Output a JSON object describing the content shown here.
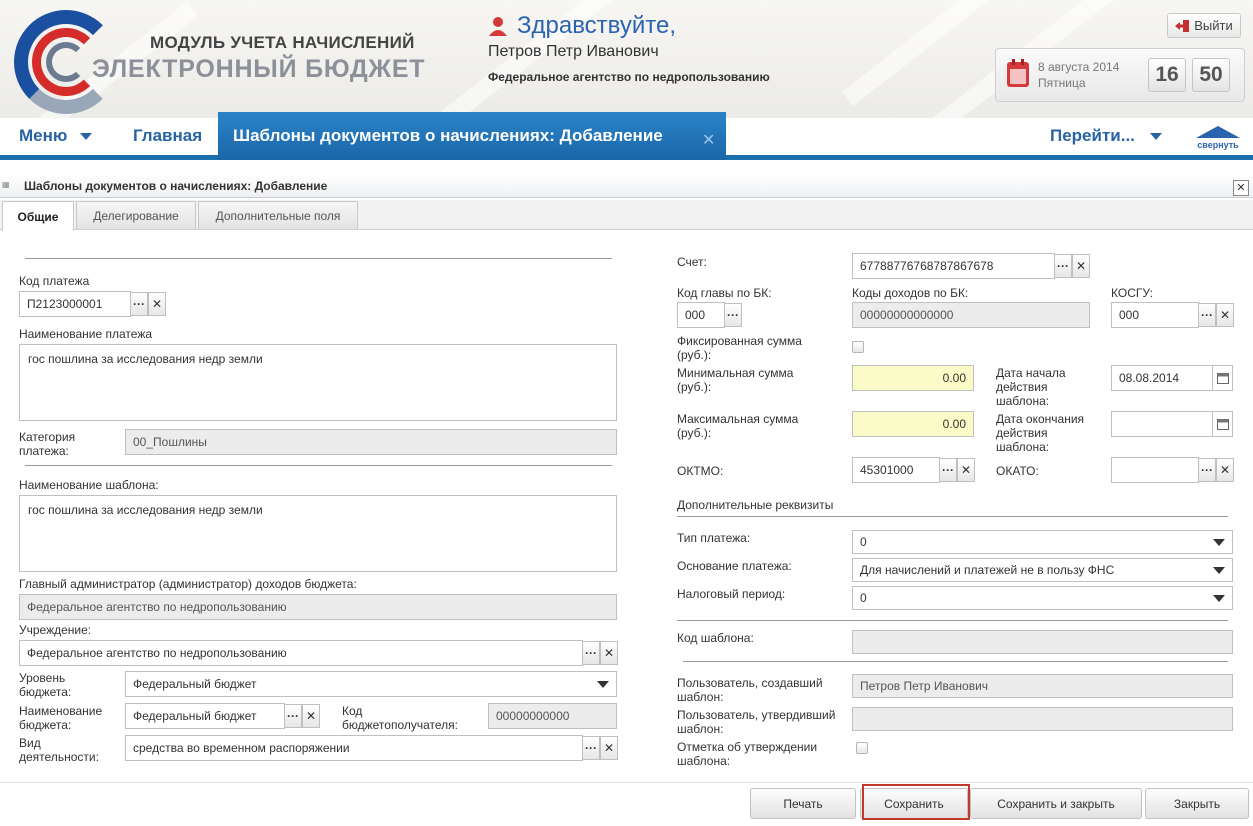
{
  "header": {
    "logo_top": "МОДУЛЬ УЧЕТА НАЧИСЛЕНИЙ",
    "logo_bottom": "ЭЛЕКТРОННЫЙ БЮДЖЕТ",
    "greeting": "Здравствуйте,",
    "user_name": "Петров Петр Иванович",
    "agency": "Федеральное агентство по недропользованию",
    "logout_label": "Выйти",
    "date": "8 августа 2014",
    "weekday": "Пятница",
    "time_hours": "16",
    "time_minutes": "50",
    "collapse_label": "свернуть"
  },
  "nav": {
    "menu_label": "Меню",
    "home_label": "Главная",
    "active_tab": "Шаблоны документов о начислениях: Добавление",
    "goto_label": "Перейти..."
  },
  "panel": {
    "title": "Шаблоны документов о начислениях: Добавление",
    "tabs": [
      "Общие",
      "Делегирование",
      "Дополнительные поля"
    ]
  },
  "left": {
    "payment_code_label": "Код платежа",
    "payment_code": "П2123000001",
    "payment_name_label": "Наименование платежа",
    "payment_name": "гос пошлина за исследования недр земли",
    "category_label": "Категория платежа:",
    "category": "00_Пошлины",
    "template_name_label": "Наименование шаблона:",
    "template_name": "гос пошлина за исследования недр земли",
    "admin_label": "Главный администратор (администратор) доходов бюджета:",
    "admin": "Федеральное агентство по недропользованию",
    "institution_label": "Учреждение:",
    "institution": "Федеральное агентство по недропользованию",
    "budget_level_label": "Уровень бюджета:",
    "budget_level": "Федеральный бюджет",
    "budget_name_label": "Наименование бюджета:",
    "budget_name": "Федеральный бюджет",
    "recipient_code_label": "Код бюджетополучателя:",
    "recipient_code": "00000000000",
    "activity_label": "Вид деятельности:",
    "activity": "средства во временном распоряжении"
  },
  "right": {
    "account_label": "Счет:",
    "account": "67788776768787867678",
    "chapter_label": "Код главы по БК:",
    "chapter": "000",
    "income_codes_label": "Коды доходов по БК:",
    "income_codes": "00000000000000",
    "kosgu_label": "КОСГУ:",
    "kosgu": "000",
    "fixed_label": "Фиксированная сумма (руб.):",
    "min_label": "Минимальная сумма (руб.):",
    "min_value": "0.00",
    "max_label": "Максимальная сумма (руб.):",
    "max_value": "0.00",
    "start_label": "Дата начала действия шаблона:",
    "start_date": "08.08.2014",
    "end_label": "Дата окончания действия шаблона:",
    "end_date": "",
    "oktmo_label": "ОКТМО:",
    "oktmo": "45301000",
    "okato_label": "ОКАТО:",
    "okato": "",
    "extra_label": "Дополнительные реквизиты",
    "pay_type_label": "Тип платежа:",
    "pay_type": "0",
    "basis_label": "Основание платежа:",
    "basis": "Для начислений и платежей не в пользу ФНС",
    "tax_period_label": "Налоговый период:",
    "tax_period": "0",
    "template_code_label": "Код шаблона:",
    "template_code": "",
    "creator_label": "Пользователь, создавший шаблон:",
    "creator": "Петров Петр Иванович",
    "approver_label": "Пользователь, утвердивший шаблон:",
    "approver": "",
    "approved_label": "Отметка об утверждении шаблона:"
  },
  "footer": {
    "print": "Печать",
    "save": "Сохранить",
    "save_close": "Сохранить и закрыть",
    "close": "Закрыть"
  },
  "colors": {
    "accent": "#1c6fae",
    "link": "#2763a5",
    "highlight": "#c0392b",
    "required": "#fbfbc8"
  }
}
